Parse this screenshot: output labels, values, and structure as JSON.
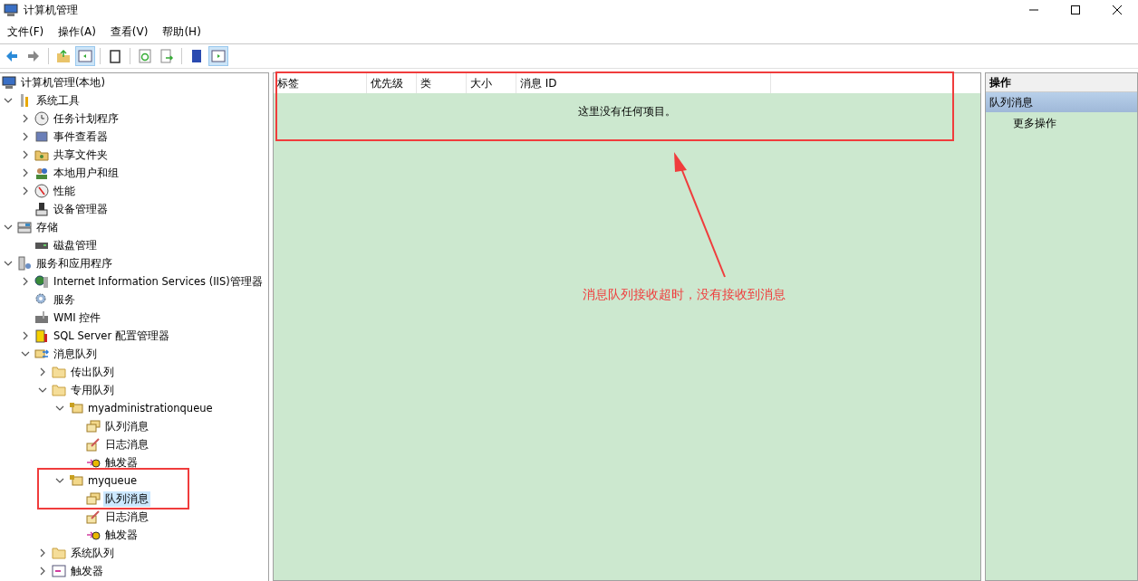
{
  "window": {
    "title": "计算机管理"
  },
  "menu": [
    "文件(F)",
    "操作(A)",
    "查看(V)",
    "帮助(H)"
  ],
  "tree": [
    {
      "label": "计算机管理(本地)",
      "kind": "computer",
      "selected": false,
      "children": [
        {
          "label": "系统工具",
          "kind": "tools",
          "expanded": true,
          "selected": false,
          "children": [
            {
              "label": "任务计划程序",
              "kind": "clock",
              "expanded": false,
              "selected": false
            },
            {
              "label": "事件查看器",
              "kind": "eventlog",
              "expanded": false,
              "selected": false
            },
            {
              "label": "共享文件夹",
              "kind": "shared",
              "expanded": false,
              "selected": false
            },
            {
              "label": "本地用户和组",
              "kind": "users",
              "expanded": false,
              "selected": false
            },
            {
              "label": "性能",
              "kind": "gauge",
              "expanded": false,
              "selected": false
            },
            {
              "label": "设备管理器",
              "kind": "device",
              "selected": false
            }
          ]
        },
        {
          "label": "存储",
          "kind": "storage",
          "expanded": true,
          "selected": false,
          "children": [
            {
              "label": "磁盘管理",
              "kind": "disk",
              "selected": false
            }
          ]
        },
        {
          "label": "服务和应用程序",
          "kind": "services",
          "expanded": true,
          "selected": false,
          "children": [
            {
              "label": "Internet Information Services (IIS)管理器",
              "kind": "iis",
              "expanded": false,
              "selected": false
            },
            {
              "label": "服务",
              "kind": "gear",
              "selected": false
            },
            {
              "label": "WMI 控件",
              "kind": "wmi",
              "selected": false
            },
            {
              "label": "SQL Server 配置管理器",
              "kind": "sql",
              "expanded": false,
              "selected": false
            },
            {
              "label": "消息队列",
              "kind": "mq",
              "expanded": true,
              "selected": false,
              "children": [
                {
                  "label": "传出队列",
                  "kind": "folder",
                  "expanded": false,
                  "selected": false
                },
                {
                  "label": "专用队列",
                  "kind": "folder",
                  "expanded": true,
                  "selected": false,
                  "children": [
                    {
                      "label": "myadministrationqueue",
                      "kind": "queue",
                      "expanded": true,
                      "selected": false,
                      "children": [
                        {
                          "label": "队列消息",
                          "kind": "messages",
                          "selected": false
                        },
                        {
                          "label": "日志消息",
                          "kind": "journal",
                          "selected": false
                        },
                        {
                          "label": "触发器",
                          "kind": "trigger",
                          "selected": false
                        }
                      ]
                    },
                    {
                      "label": "myqueue",
                      "kind": "queue",
                      "expanded": true,
                      "selected": false,
                      "children": [
                        {
                          "label": "队列消息",
                          "kind": "messages",
                          "selected": true
                        },
                        {
                          "label": "日志消息",
                          "kind": "journal",
                          "selected": false
                        },
                        {
                          "label": "触发器",
                          "kind": "trigger",
                          "selected": false
                        }
                      ]
                    }
                  ]
                },
                {
                  "label": "系统队列",
                  "kind": "folder",
                  "expanded": false,
                  "selected": false
                },
                {
                  "label": "触发器",
                  "kind": "triggerlist",
                  "expanded": false,
                  "selected": false
                }
              ]
            }
          ]
        }
      ]
    }
  ],
  "table": {
    "columns": [
      "标签",
      "优先级",
      "类",
      "大小",
      "消息 ID"
    ],
    "empty_message": "这里没有任何项目。"
  },
  "actions": {
    "title": "操作",
    "section": "队列消息",
    "items": [
      "更多操作"
    ]
  },
  "annotation": {
    "text": "消息队列接收超时，没有接收到消息"
  }
}
